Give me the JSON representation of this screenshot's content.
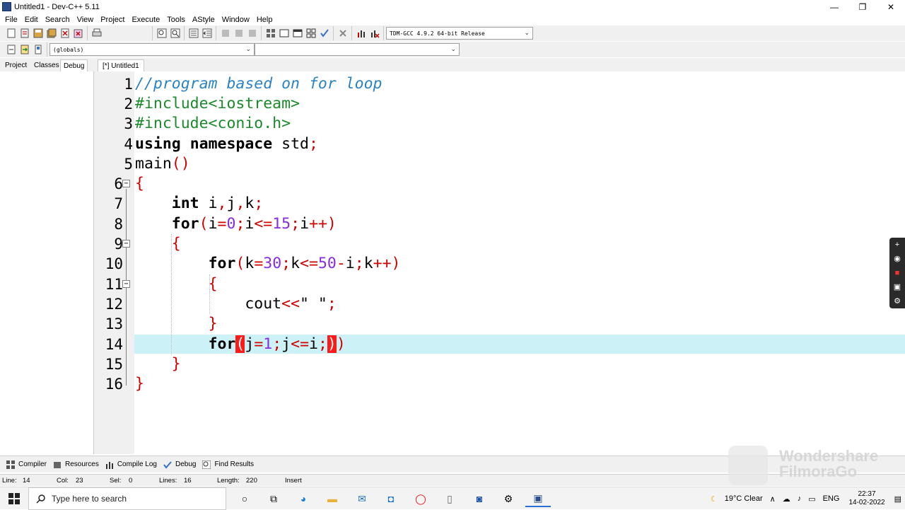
{
  "window": {
    "title": "Untitled1 - Dev-C++ 5.11",
    "minimize": "—",
    "maximize": "❐",
    "close": "✕"
  },
  "menu": [
    "File",
    "Edit",
    "Search",
    "View",
    "Project",
    "Execute",
    "Tools",
    "AStyle",
    "Window",
    "Help"
  ],
  "toolbar": {
    "compiler_select": "TDM-GCC 4.9.2 64-bit Release",
    "scope_select": "(globals)",
    "member_select": ""
  },
  "left_tabs": [
    "Project",
    "Classes",
    "Debug"
  ],
  "editor_tab": "[*] Untitled1",
  "code": {
    "line_numbers": [
      "1",
      "2",
      "3",
      "4",
      "5",
      "6",
      "7",
      "8",
      "9",
      "10",
      "11",
      "12",
      "13",
      "14",
      "15",
      "16"
    ],
    "l1_comment": "//program based on for loop",
    "l2_pp": "#include<iostream>",
    "l3_pp": "#include<conio.h>",
    "l4_kw1": "using",
    "l4_kw2": "namespace",
    "l4_id": " std",
    "l5_id": "main",
    "l7_kw": "int",
    "l7_vars": [
      "i",
      "j",
      "k"
    ],
    "l8_kw": "for",
    "l8_init": "i",
    "l8_zero": "0",
    "l8_cond": "i",
    "l8_limit": "15",
    "l8_inc": "i",
    "l10_kw": "for",
    "l10_init": "k",
    "l10_start": "30",
    "l10_cond": "k",
    "l10_limit": "50",
    "l10_i": "i",
    "l10_inc": "k",
    "l12_id": "cout",
    "l12_str": "\" \"",
    "l14_kw": "for",
    "l14_init": "j",
    "l14_one": "1",
    "l14_cond": "j",
    "l14_lim": "i"
  },
  "bottom_tabs": [
    "Compiler",
    "Resources",
    "Compile Log",
    "Debug",
    "Find Results"
  ],
  "status": {
    "line_label": "Line:",
    "line": "14",
    "col_label": "Col:",
    "col": "23",
    "sel_label": "Sel:",
    "sel": "0",
    "lines_label": "Lines:",
    "lines": "16",
    "length_label": "Length:",
    "length": "220",
    "mode": "Insert"
  },
  "watermark": {
    "line1": "Wondershare",
    "line2": "FilmoraGo"
  },
  "taskbar": {
    "search_placeholder": "Type here to search",
    "weather": "19°C  Clear",
    "lang": "ENG",
    "time": "22:37",
    "date": "14-02-2022"
  },
  "colors": {
    "highlight_line": "#ccf2f7",
    "comment": "#2b83c4",
    "preprocessor": "#1a8a2a",
    "symbol": "#d00000",
    "number": "#8a2be2",
    "bracket_match": "#ff1a1a"
  }
}
